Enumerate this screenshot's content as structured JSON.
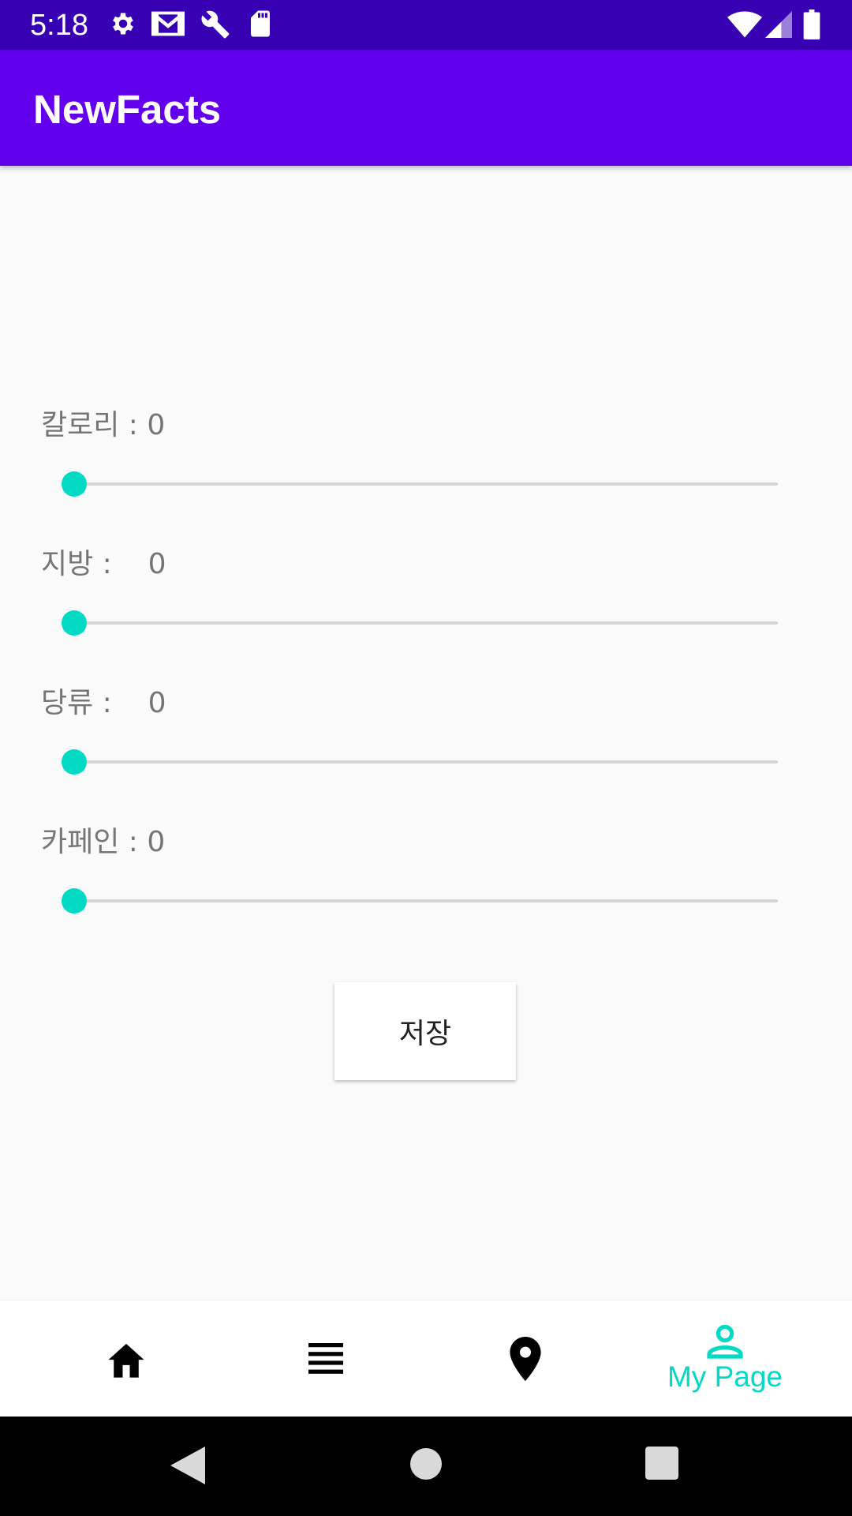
{
  "status_bar": {
    "time": "5:18",
    "icons_left": [
      "gear-icon",
      "gmail-icon",
      "wrench-icon",
      "sd-card-icon"
    ],
    "icons_right": [
      "wifi-icon",
      "signal-icon",
      "battery-icon"
    ]
  },
  "app_bar": {
    "title": "NewFacts"
  },
  "sliders": [
    {
      "label": "칼로리 : 0",
      "value": 0
    },
    {
      "label": "지방 :    0",
      "value": 0
    },
    {
      "label": "당류 :    0",
      "value": 0
    },
    {
      "label": "카페인 : 0",
      "value": 0
    }
  ],
  "save_button": {
    "label": "저장"
  },
  "bottom_nav": {
    "items": [
      {
        "icon": "home-icon",
        "label": ""
      },
      {
        "icon": "list-icon",
        "label": ""
      },
      {
        "icon": "location-pin-icon",
        "label": ""
      },
      {
        "icon": "person-icon",
        "label": "My Page",
        "selected": true
      }
    ]
  },
  "colors": {
    "status_bar": "#3700b3",
    "app_bar": "#6200ee",
    "accent": "#03dac5",
    "background": "#fafafa"
  }
}
